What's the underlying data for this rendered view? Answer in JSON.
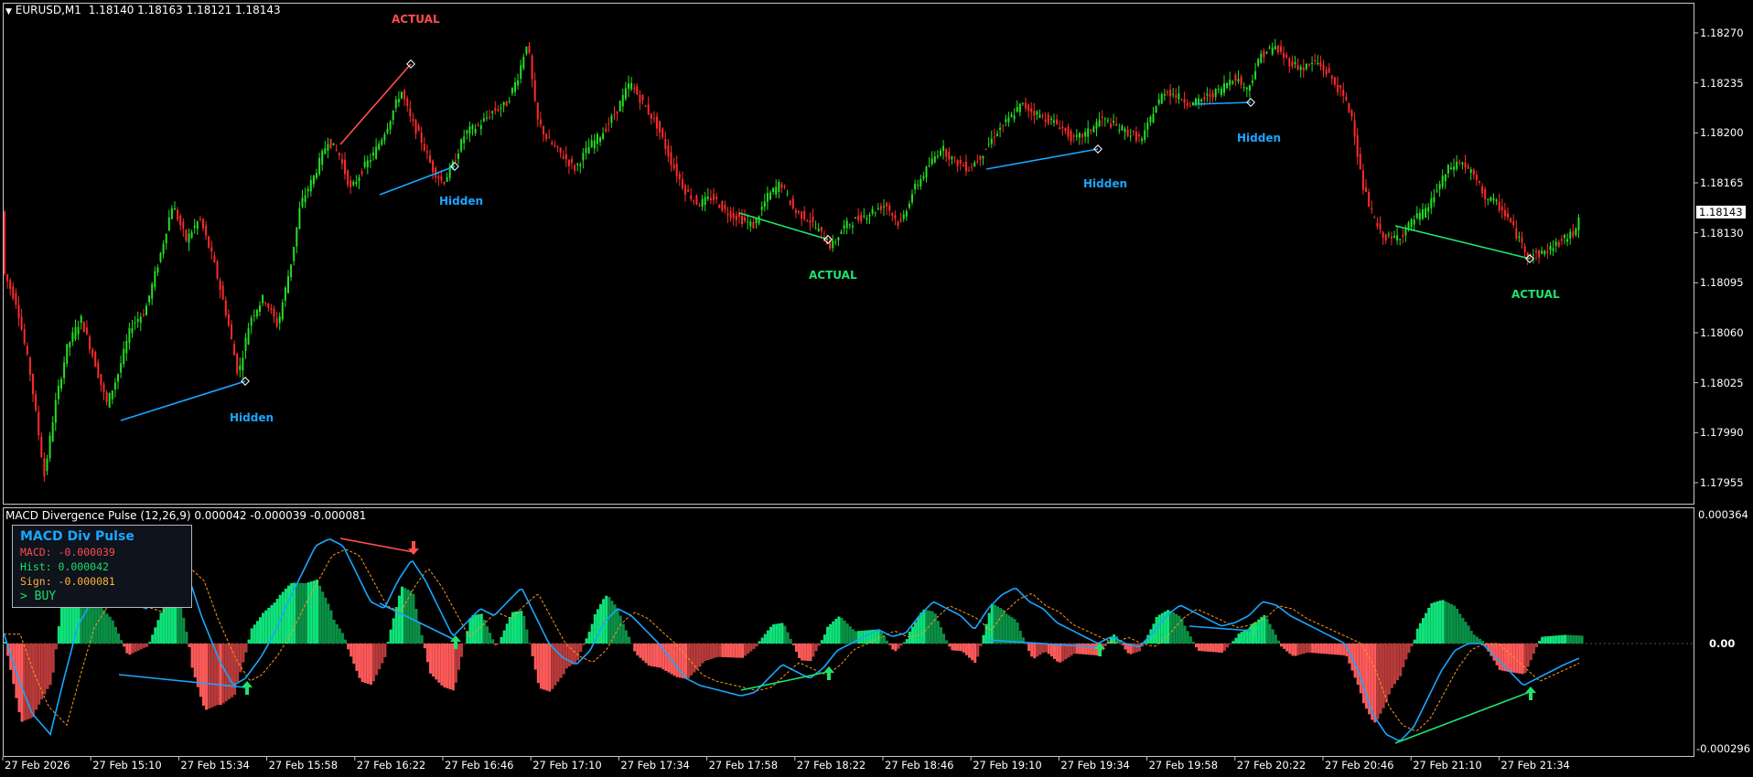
{
  "main_chart": {
    "header": {
      "symbol": "EURUSD,M1",
      "ohlc": "1.18140 1.18163 1.18121 1.18143"
    },
    "price_labels": [
      "1.18270",
      "1.18235",
      "1.18200",
      "1.18165",
      "1.18130",
      "1.18095",
      "1.18060",
      "1.18025",
      "1.17990",
      "1.17955"
    ],
    "price_min": 1.1793,
    "price_max": 1.1829,
    "current_price": "1.18143",
    "annotations": [
      {
        "text": "ACTUAL",
        "color": "#ff4d4d"
      },
      {
        "text": "Hidden",
        "color": "#1aa6ff"
      },
      {
        "text": "Hidden",
        "color": "#1aa6ff"
      },
      {
        "text": "ACTUAL",
        "color": "#1ee36e"
      },
      {
        "text": "Hidden",
        "color": "#1aa6ff"
      },
      {
        "text": "Hidden",
        "color": "#1aa6ff"
      },
      {
        "text": "ACTUAL",
        "color": "#1ee36e"
      }
    ],
    "bull_color": "#22e022",
    "bear_color": "#ff2a2a"
  },
  "indicator": {
    "header": "MACD Divergence Pulse (12,26,9) 0.000042 -0.000039 -0.000081",
    "scale_labels": [
      "0.000364",
      "0.00",
      "-0.000296"
    ],
    "value_min": -0.000296,
    "value_max": 0.000364,
    "macd_color": "#1aa6ff",
    "signal_color": "#ff9a1a"
  },
  "info_panel": {
    "title": "MACD Div Pulse",
    "macd": "MACD: -0.000039",
    "hist": "Hist: 0.000042",
    "sign": "Sign: -0.000081",
    "signal": "> BUY",
    "macd_color": "#ff4d4d",
    "hist_color": "#17e06a",
    "sign_color": "#ffb23a"
  },
  "time_labels": [
    "27 Feb 2026",
    "27 Feb 15:10",
    "27 Feb 15:34",
    "27 Feb 15:58",
    "27 Feb 16:22",
    "27 Feb 16:46",
    "27 Feb 17:10",
    "27 Feb 17:34",
    "27 Feb 17:58",
    "27 Feb 18:22",
    "27 Feb 18:46",
    "27 Feb 19:10",
    "27 Feb 19:34",
    "27 Feb 19:58",
    "27 Feb 20:22",
    "27 Feb 20:46",
    "27 Feb 21:10",
    "27 Feb 21:34"
  ]
}
